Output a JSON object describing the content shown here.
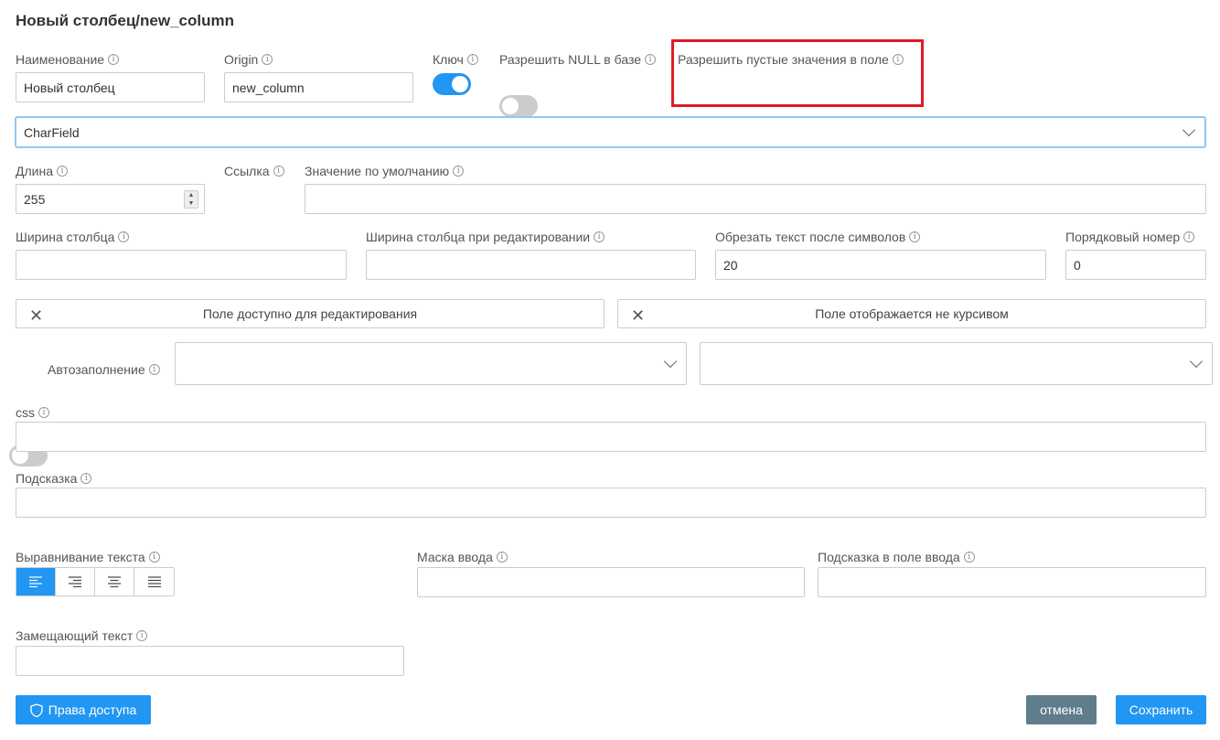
{
  "title": "Новый столбец/new_column",
  "fields": {
    "name": {
      "label": "Наименование",
      "value": "Новый столбец"
    },
    "origin": {
      "label": "Origin",
      "value": "new_column"
    },
    "key": {
      "label": "Ключ",
      "on": true
    },
    "allow_null": {
      "label": "Разрешить NULL в базе",
      "on": false
    },
    "allow_empty": {
      "label": "Разрешить пустые значения в поле",
      "on": false
    },
    "field_type": {
      "value": "CharField"
    },
    "length": {
      "label": "Длина",
      "value": "255"
    },
    "link": {
      "label": "Ссылка",
      "on": false
    },
    "default_value": {
      "label": "Значение по умолчанию",
      "value": ""
    },
    "column_width": {
      "label": "Ширина столбца",
      "value": ""
    },
    "edit_width": {
      "label": "Ширина столбца при редактировании",
      "value": ""
    },
    "truncate": {
      "label": "Обрезать текст после символов",
      "value": "20"
    },
    "order": {
      "label": "Порядковый номер",
      "value": "0"
    },
    "editable_chip": {
      "label": "Поле доступно для редактирования"
    },
    "italic_chip": {
      "label": "Поле отображается не курсивом"
    },
    "autofill": {
      "label": "Автозаполнение",
      "on": false
    },
    "css": {
      "label": "css",
      "value": ""
    },
    "hint": {
      "label": "Подсказка",
      "value": ""
    },
    "text_align": {
      "label": "Выравнивание текста",
      "options": [
        "left",
        "right",
        "center",
        "justify"
      ],
      "selected": "left"
    },
    "input_mask": {
      "label": "Маска ввода",
      "value": ""
    },
    "input_hint": {
      "label": "Подсказка в поле ввода",
      "value": ""
    },
    "replace_text": {
      "label": "Замещающий текст",
      "value": ""
    }
  },
  "buttons": {
    "access": "Права доступа",
    "cancel": "отмена",
    "save": "Сохранить"
  },
  "colors": {
    "accent": "#2196f3",
    "cancel": "#607d8b",
    "highlight": "#e01b24"
  }
}
